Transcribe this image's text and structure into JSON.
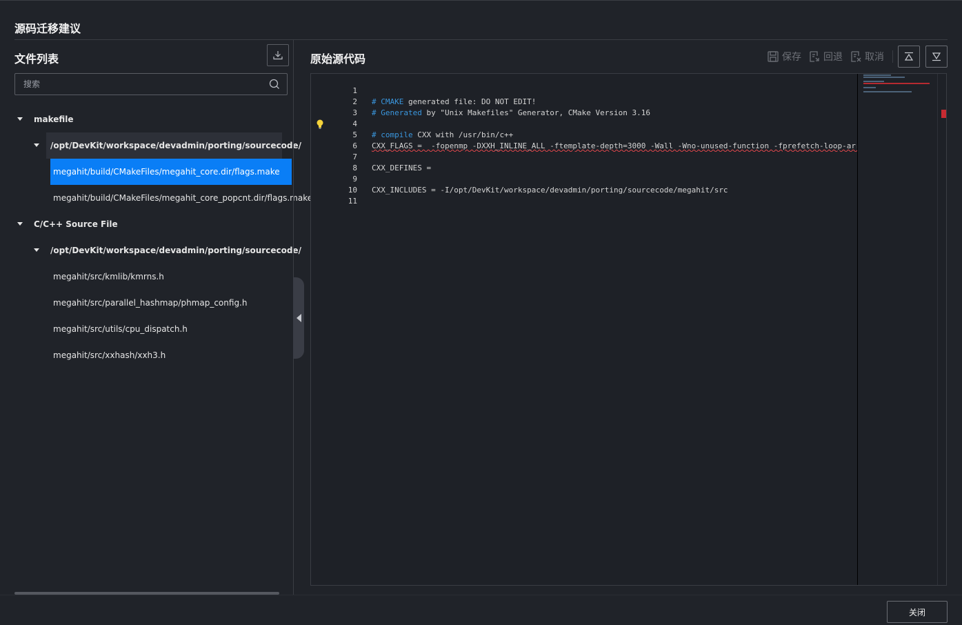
{
  "dialog": {
    "title": "源码迁移建议"
  },
  "left": {
    "title": "文件列表",
    "search_placeholder": "搜索",
    "tree": {
      "group1": "makefile",
      "group1_folder": "/opt/DevKit/workspace/devadmin/porting/sourcecode/",
      "group1_files": [
        "megahit/build/CMakeFiles/megahit_core.dir/flags.make",
        "megahit/build/CMakeFiles/megahit_core_popcnt.dir/flags.make"
      ],
      "group2": "C/C++ Source File",
      "group2_folder": "/opt/DevKit/workspace/devadmin/porting/sourcecode/",
      "group2_files": [
        "megahit/src/kmlib/kmrns.h",
        "megahit/src/parallel_hashmap/phmap_config.h",
        "megahit/src/utils/cpu_dispatch.h",
        "megahit/src/xxhash/xxh3.h"
      ]
    }
  },
  "right": {
    "title": "原始源代码",
    "toolbar": {
      "save": "保存",
      "revert": "回退",
      "cancel": "取消"
    },
    "code": {
      "l1_hash": "# ",
      "l1_kw": "CMAKE",
      "l1_rest": " generated file: DO NOT EDIT!",
      "l2_hash": "# ",
      "l2_kw": "Generated",
      "l2_rest": " by \"Unix Makefiles\" Generator, CMake Version 3.16",
      "l4_hash": "# ",
      "l4_kw": "compile",
      "l4_rest": " CXX with /usr/bin/c++",
      "l5": "CXX_FLAGS =  -fopenmp -DXXH_INLINE_ALL -ftemplate-depth=3000 -Wall -Wno-unused-function -fprefetch-loop-arrays",
      "l7": "CXX_DEFINES =",
      "l9": "CXX_INCLUDES = -I/opt/DevKit/workspace/devadmin/porting/sourcecode/megahit/src",
      "line_numbers": [
        "1",
        "2",
        "3",
        "4",
        "5",
        "6",
        "7",
        "8",
        "9",
        "10",
        "11"
      ]
    }
  },
  "footer": {
    "close_label": "关闭"
  },
  "colors": {
    "accent": "#0a7ef6",
    "comment": "#3a96dd",
    "error": "#e5484d",
    "background": "#202329"
  },
  "icons": [
    "download-icon",
    "search-icon",
    "save-icon",
    "revert-icon",
    "cancel-icon",
    "scroll-top-icon",
    "scroll-bottom-icon",
    "lightbulb-icon"
  ]
}
